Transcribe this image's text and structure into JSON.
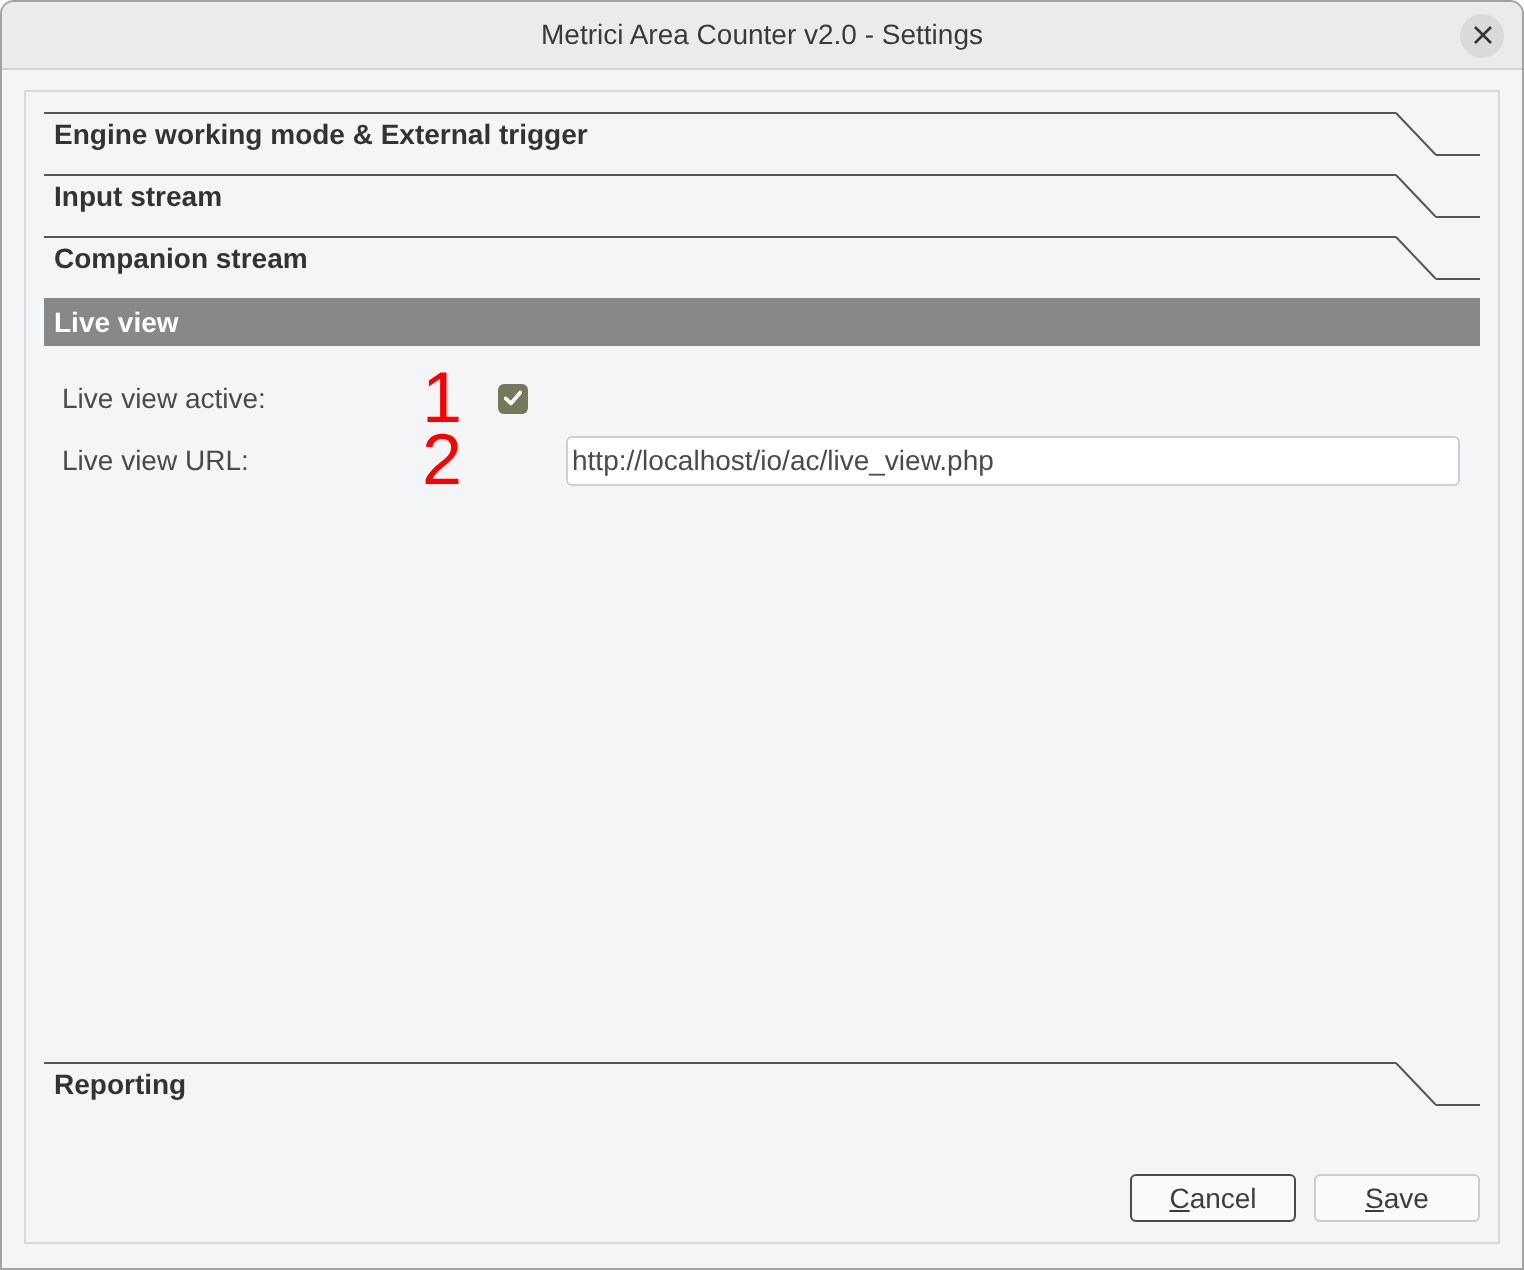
{
  "window": {
    "title": "Metrici Area Counter v2.0 - Settings"
  },
  "sections": [
    {
      "title": "Engine working mode & External trigger",
      "expanded": false
    },
    {
      "title": "Input stream",
      "expanded": false
    },
    {
      "title": "Companion stream",
      "expanded": false
    },
    {
      "title": "Live view",
      "expanded": true,
      "fields": [
        {
          "kind": "checkbox",
          "label": "Live view active:",
          "annotation": "1",
          "checked": true
        },
        {
          "kind": "text",
          "label": "Live view URL:",
          "annotation": "2",
          "value": "http://localhost/io/ac/live_view.php"
        }
      ]
    },
    {
      "title": "Reporting",
      "expanded": false
    }
  ],
  "buttons": [
    {
      "label": "Cancel",
      "focused": true,
      "mnemonic": true
    },
    {
      "label": "Save",
      "focused": false,
      "mnemonic": true
    }
  ]
}
